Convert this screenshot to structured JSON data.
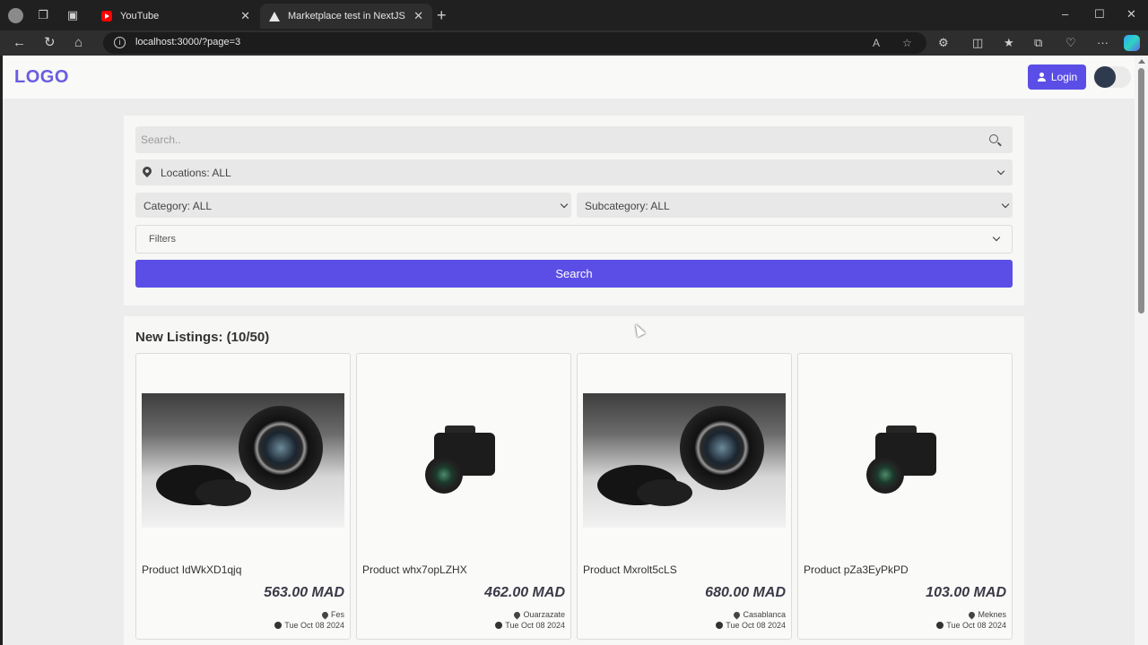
{
  "browser": {
    "tabs": [
      {
        "title": "YouTube",
        "favicon": "youtube-icon",
        "active": false
      },
      {
        "title": "Marketplace test in NextJS",
        "favicon": "nextjs-icon",
        "active": true
      }
    ],
    "url": "localhost:3000/?page=3"
  },
  "header": {
    "logo": "LOGO",
    "login_label": "Login"
  },
  "search": {
    "placeholder": "Search..",
    "location": "Locations: ALL",
    "category": "Category: ALL",
    "subcategory": "Subcategory: ALL",
    "filters": "Filters",
    "button": "Search"
  },
  "listings": {
    "title": "New Listings: (10/50)",
    "items": [
      {
        "name": "Product IdWkXD1qjq",
        "price": "563.00 MAD",
        "location": "Fes",
        "date": "Tue Oct 08 2024",
        "image": "lens-photo"
      },
      {
        "name": "Product whx7opLZHX",
        "price": "462.00 MAD",
        "location": "Ouarzazate",
        "date": "Tue Oct 08 2024",
        "image": "camera-photo"
      },
      {
        "name": "Product Mxrolt5cLS",
        "price": "680.00 MAD",
        "location": "Casablanca",
        "date": "Tue Oct 08 2024",
        "image": "lens-photo"
      },
      {
        "name": "Product pZa3EyPkPD",
        "price": "103.00 MAD",
        "location": "Meknes",
        "date": "Tue Oct 08 2024",
        "image": "camera-photo"
      }
    ]
  },
  "colors": {
    "accent": "#5b4ee6",
    "logo": "#6a5ce0"
  }
}
